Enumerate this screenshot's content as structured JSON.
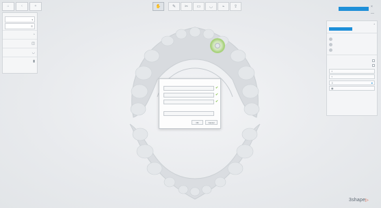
{
  "top_left": {
    "buttons": [
      {
        "label": "",
        "icon": "home-icon"
      },
      {
        "label": "",
        "icon": "back-icon"
      },
      {
        "label": "",
        "icon": "add-icon"
      }
    ]
  },
  "toolbar": {
    "tools": [
      {
        "icon": "jaw-tool-icon"
      },
      {
        "icon": "scan-tool-icon"
      },
      {
        "icon": "edit-tool-icon"
      },
      {
        "icon": "scan-view-icon"
      },
      {
        "icon": "bite-icon"
      },
      {
        "icon": "analyze-icon"
      },
      {
        "icon": "export-icon"
      }
    ]
  },
  "window": {
    "close": "×",
    "minimize": "—"
  },
  "left_panel": {
    "title": "",
    "selector_value": "",
    "selector_icon": "chevron-down-icon",
    "rows": [
      {
        "label": "",
        "icon": "tooth-icon"
      },
      {
        "label": "",
        "icon": "ruler-icon"
      },
      {
        "label": "",
        "icon": "arc-icon"
      },
      {
        "label": "",
        "icon": "slider-icon"
      }
    ]
  },
  "right_panel": {
    "header": "",
    "add_label": "",
    "section_title": "",
    "section_action": "",
    "items": [
      {
        "label": ""
      },
      {
        "label": ""
      },
      {
        "label": ""
      }
    ],
    "options_title": "",
    "checks": [
      {
        "label": ""
      },
      {
        "label": ""
      }
    ],
    "buttons": [
      {
        "label": "",
        "icon": "plus-icon"
      },
      {
        "label": "",
        "icon": "attach-icon"
      },
      {
        "label": "",
        "icon": "export-icon"
      },
      {
        "label": "",
        "icon": "eye-icon"
      }
    ]
  },
  "dialog": {
    "title": "",
    "suggested": [
      {
        "label": ""
      },
      {
        "label": ""
      },
      {
        "label": ""
      }
    ],
    "optional_title": "",
    "optional": [
      {
        "label": ""
      }
    ],
    "ok_label": "OK",
    "cancel_label": "Cancel"
  },
  "brand": {
    "name": "3shape",
    "mark": "▷"
  },
  "colors": {
    "accent": "#1e8fd8",
    "check": "#7cbb3a",
    "marker": "#9ccc6a",
    "brand_mark": "#e14a2b"
  }
}
